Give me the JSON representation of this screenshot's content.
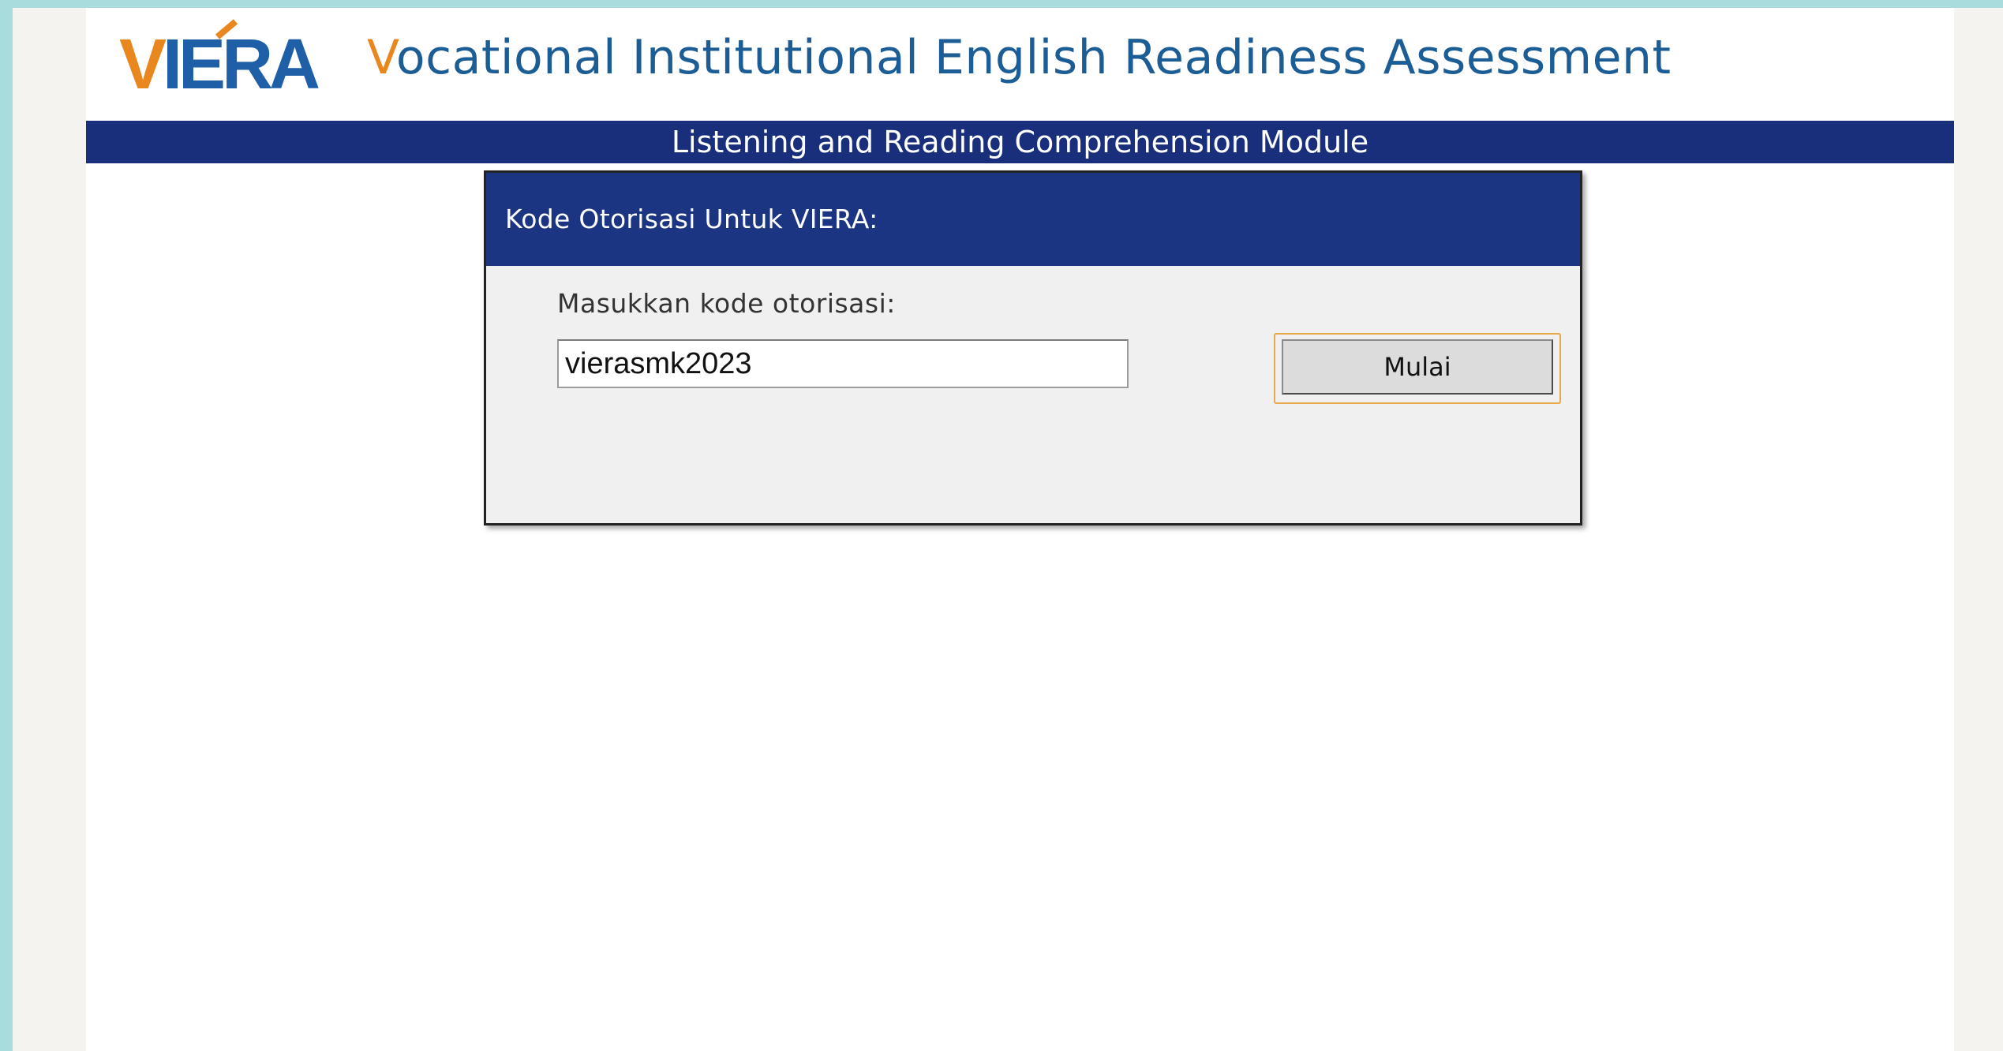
{
  "header": {
    "logo_first": "V",
    "logo_rest": "IERA",
    "title_first": "V",
    "title_rest": "ocational Institutional English Readiness Assessment"
  },
  "module_bar": {
    "label": "Listening and Reading Comprehension Module"
  },
  "auth": {
    "title": "Kode Otorisasi Untuk VIERA:",
    "prompt": "Masukkan kode otorisasi:",
    "code_value": "vierasmk2023",
    "start_label": "Mulai"
  },
  "colors": {
    "brand_orange": "#e9871f",
    "brand_blue": "#1f5fa8",
    "navy_bar": "#1a2f7c",
    "focus_outline": "#e9a94a",
    "outer_background": "#a9dcdc"
  }
}
